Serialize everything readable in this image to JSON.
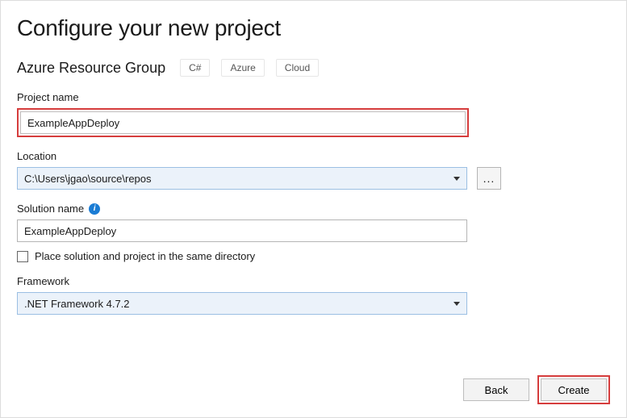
{
  "title": "Configure your new project",
  "templateName": "Azure Resource Group",
  "tags": [
    "C#",
    "Azure",
    "Cloud"
  ],
  "fields": {
    "projectName": {
      "label": "Project name",
      "value": "ExampleAppDeploy"
    },
    "location": {
      "label": "Location",
      "value": "C:\\Users\\jgao\\source\\repos",
      "browseLabel": "..."
    },
    "solutionName": {
      "label": "Solution name",
      "value": "ExampleAppDeploy"
    },
    "sameDir": {
      "label": "Place solution and project in the same directory",
      "checked": false
    },
    "framework": {
      "label": "Framework",
      "value": ".NET Framework 4.7.2"
    }
  },
  "buttons": {
    "back": "Back",
    "create": "Create"
  },
  "icons": {
    "info": "i"
  }
}
